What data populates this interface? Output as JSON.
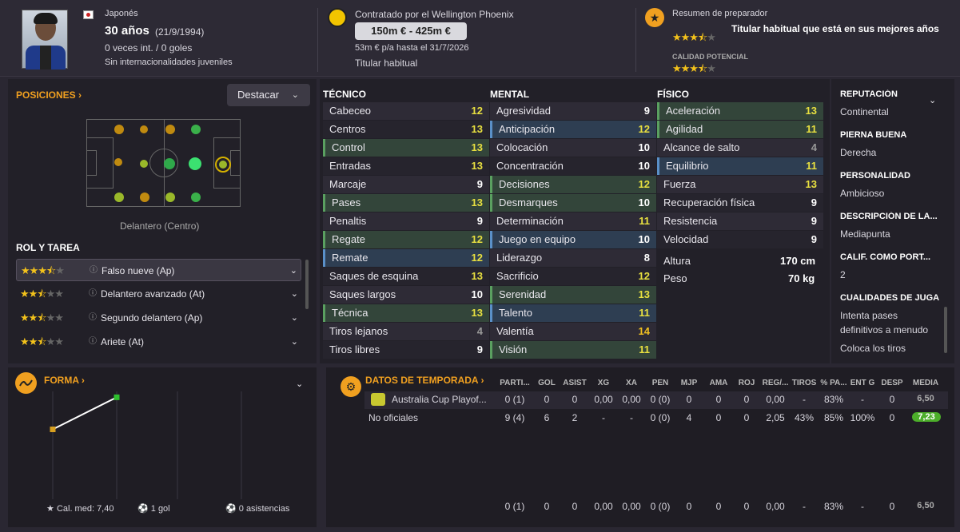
{
  "header": {
    "nationality": "Japonés",
    "age": "30 años",
    "dob": "(21/9/1994)",
    "caps": "0 veces int. / 0 goles",
    "youth_caps": "Sin internacionalidades juveniles",
    "contract": "Contratado por el Wellington Phoenix",
    "value": "150m € - 425m €",
    "wage": "53m € p/a hasta el 31/7/2026",
    "status": "Titular habitual",
    "coach_title": "Resumen de preparador",
    "coach_summary": "Titular habitual que está en sus mejores años",
    "potential_label": "CALIDAD POTENCIAL",
    "current_stars": 3.5,
    "potential_stars": 3.5
  },
  "positions": {
    "title": "POSICIONES",
    "dropdown": "Destacar",
    "position_name": "Delantero (Centro)",
    "role_title": "ROL Y TAREA",
    "roles": [
      {
        "label": "Falso nueve (Ap)",
        "stars": 3.5
      },
      {
        "label": "Delantero avanzado (At)",
        "stars": 2.5
      },
      {
        "label": "Segundo delantero (Ap)",
        "stars": 2.5
      },
      {
        "label": "Ariete (At)",
        "stars": 2.5
      }
    ]
  },
  "technical": {
    "title": "TÉCNICO",
    "attrs": [
      {
        "n": "Cabeceo",
        "v": "12"
      },
      {
        "n": "Centros",
        "v": "13"
      },
      {
        "n": "Control",
        "v": "13"
      },
      {
        "n": "Entradas",
        "v": "13"
      },
      {
        "n": "Marcaje",
        "v": "9"
      },
      {
        "n": "Pases",
        "v": "13"
      },
      {
        "n": "Penaltis",
        "v": "9"
      },
      {
        "n": "Regate",
        "v": "12"
      },
      {
        "n": "Remate",
        "v": "12"
      },
      {
        "n": "Saques de esquina",
        "v": "13"
      },
      {
        "n": "Saques largos",
        "v": "10"
      },
      {
        "n": "Técnica",
        "v": "13"
      },
      {
        "n": "Tiros lejanos",
        "v": "4"
      },
      {
        "n": "Tiros libres",
        "v": "9"
      }
    ]
  },
  "mental": {
    "title": "MENTAL",
    "attrs": [
      {
        "n": "Agresividad",
        "v": "9"
      },
      {
        "n": "Anticipación",
        "v": "12"
      },
      {
        "n": "Colocación",
        "v": "10"
      },
      {
        "n": "Concentración",
        "v": "10"
      },
      {
        "n": "Decisiones",
        "v": "12"
      },
      {
        "n": "Desmarques",
        "v": "10"
      },
      {
        "n": "Determinación",
        "v": "11"
      },
      {
        "n": "Juego en equipo",
        "v": "10"
      },
      {
        "n": "Liderazgo",
        "v": "8"
      },
      {
        "n": "Sacrificio",
        "v": "12"
      },
      {
        "n": "Serenidad",
        "v": "13"
      },
      {
        "n": "Talento",
        "v": "11"
      },
      {
        "n": "Valentía",
        "v": "14"
      },
      {
        "n": "Visión",
        "v": "11"
      }
    ]
  },
  "physical": {
    "title": "FÍSICO",
    "attrs": [
      {
        "n": "Aceleración",
        "v": "13"
      },
      {
        "n": "Agilidad",
        "v": "11"
      },
      {
        "n": "Alcance de salto",
        "v": "4"
      },
      {
        "n": "Equilibrio",
        "v": "11"
      },
      {
        "n": "Fuerza",
        "v": "13"
      },
      {
        "n": "Recuperación física",
        "v": "9"
      },
      {
        "n": "Resistencia",
        "v": "9"
      },
      {
        "n": "Velocidad",
        "v": "9"
      }
    ],
    "height_label": "Altura",
    "height": "170 cm",
    "weight_label": "Peso",
    "weight": "70 kg"
  },
  "side": [
    {
      "k": "REPUTACIÓN",
      "v": "Continental"
    },
    {
      "k": "PIERNA BUENA",
      "v": "Derecha"
    },
    {
      "k": "PERSONALIDAD",
      "v": "Ambicioso"
    },
    {
      "k": "DESCRIPCIÓN DE LA...",
      "v": "Mediapunta"
    },
    {
      "k": "CALIF. COMO PORT...",
      "v": "2"
    },
    {
      "k": "CUALIDADES DE JUGA",
      "v": "Intenta pases definitivos a menudo"
    }
  ],
  "side_extra": "Coloca los tiros",
  "form": {
    "title": "FORMA",
    "avg": "Cal. med: 7,40",
    "goals": "1 gol",
    "assists": "0 asistencias",
    "points": [
      6.5,
      7.23
    ]
  },
  "season": {
    "title": "DATOS DE TEMPORADA",
    "cols": [
      "PARTI...",
      "GOL",
      "ASIST",
      "XG",
      "XA",
      "PEN",
      "MJP",
      "AMA",
      "ROJ",
      "REG/...",
      "TIROS",
      "% PA...",
      "ENT G",
      "DESP",
      "MEDIA"
    ],
    "rows": [
      {
        "name": "Australia Cup Playof...",
        "vals": [
          "0 (1)",
          "0",
          "0",
          "0,00",
          "0,00",
          "0 (0)",
          "0",
          "0",
          "0",
          "0,00",
          "-",
          "83%",
          "-",
          "0",
          "6,50"
        ]
      },
      {
        "name": "No oficiales",
        "vals": [
          "9 (4)",
          "6",
          "2",
          "-",
          "-",
          "0 (0)",
          "4",
          "0",
          "0",
          "2,05",
          "43%",
          "85%",
          "100%",
          "0",
          "7,23"
        ]
      }
    ],
    "total": [
      "0 (1)",
      "0",
      "0",
      "0,00",
      "0,00",
      "0 (0)",
      "0",
      "0",
      "0",
      "0,00",
      "-",
      "83%",
      "-",
      "0",
      "6,50"
    ]
  }
}
